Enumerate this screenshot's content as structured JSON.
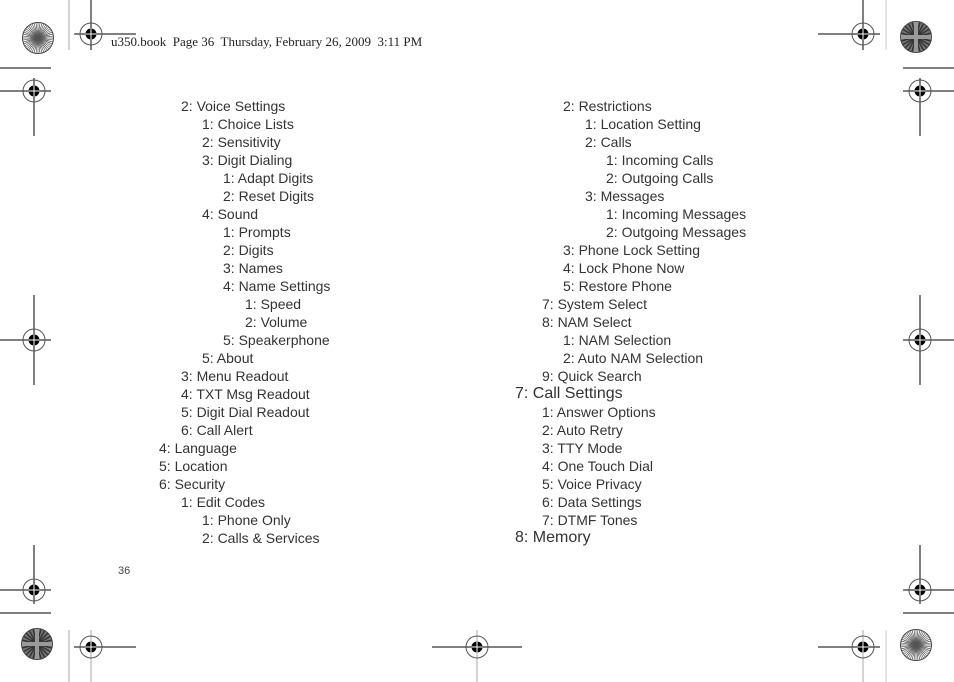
{
  "header": {
    "slug": "u350.book  Page 36  Thursday, February 26, 2009  3:11 PM"
  },
  "page_number": "36",
  "left_column": [
    {
      "text": "2: Voice Settings",
      "level": 1
    },
    {
      "text": "1: Choice Lists",
      "level": 2
    },
    {
      "text": "2: Sensitivity",
      "level": 2
    },
    {
      "text": "3: Digit Dialing",
      "level": 2
    },
    {
      "text": "1: Adapt Digits",
      "level": 3
    },
    {
      "text": "2: Reset Digits",
      "level": 3
    },
    {
      "text": "4: Sound",
      "level": 2
    },
    {
      "text": "1: Prompts",
      "level": 3
    },
    {
      "text": "2: Digits",
      "level": 3
    },
    {
      "text": "3: Names",
      "level": 3
    },
    {
      "text": "4: Name Settings",
      "level": 3
    },
    {
      "text": "1: Speed",
      "level": 4
    },
    {
      "text": "2: Volume",
      "level": 4
    },
    {
      "text": "5: Speakerphone",
      "level": 3
    },
    {
      "text": "5: About",
      "level": 2
    },
    {
      "text": "3: Menu Readout",
      "level": 1
    },
    {
      "text": "4: TXT Msg Readout",
      "level": 1
    },
    {
      "text": "5: Digit Dial Readout",
      "level": 1
    },
    {
      "text": "6: Call Alert",
      "level": 1
    },
    {
      "text": "4: Language",
      "level": 0
    },
    {
      "text": "5: Location",
      "level": 0
    },
    {
      "text": "6: Security",
      "level": 0
    },
    {
      "text": "1: Edit Codes",
      "level": 1
    },
    {
      "text": "1: Phone Only",
      "level": 2
    },
    {
      "text": "2: Calls & Services",
      "level": 2
    }
  ],
  "right_column": [
    {
      "text": "2: Restrictions",
      "level": 2
    },
    {
      "text": "1: Location Setting",
      "level": 3
    },
    {
      "text": "2: Calls",
      "level": 3
    },
    {
      "text": "1: Incoming Calls",
      "level": 4
    },
    {
      "text": "2: Outgoing Calls",
      "level": 4
    },
    {
      "text": "3: Messages",
      "level": 3
    },
    {
      "text": "1: Incoming Messages",
      "level": 4
    },
    {
      "text": "2: Outgoing Messages",
      "level": 4
    },
    {
      "text": "3: Phone Lock Setting",
      "level": 2
    },
    {
      "text": "4: Lock Phone Now",
      "level": 2
    },
    {
      "text": "5: Restore Phone",
      "level": 2
    },
    {
      "text": "7: System Select",
      "level": 1
    },
    {
      "text": "8: NAM Select",
      "level": 1
    },
    {
      "text": "1: NAM Selection",
      "level": 2
    },
    {
      "text": "2: Auto NAM Selection",
      "level": 2
    },
    {
      "text": "9: Quick Search",
      "level": 1
    },
    {
      "text": "7: Call Settings",
      "level": 0
    },
    {
      "text": "1: Answer Options",
      "level": 1
    },
    {
      "text": "2: Auto Retry",
      "level": 1
    },
    {
      "text": "3: TTY Mode",
      "level": 1
    },
    {
      "text": "4: One Touch Dial",
      "level": 1
    },
    {
      "text": "5: Voice Privacy",
      "level": 1
    },
    {
      "text": "6: Data Settings",
      "level": 1
    },
    {
      "text": "7: DTMF Tones",
      "level": 1
    },
    {
      "text": "8: Memory",
      "level": 0
    }
  ],
  "colors": {
    "text": "#333333",
    "marks": "#000000",
    "rule_gray": "#999999"
  }
}
